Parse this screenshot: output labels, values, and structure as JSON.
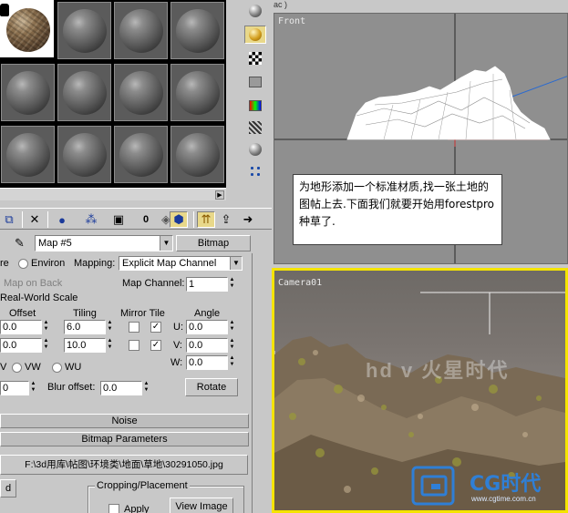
{
  "material_editor": {
    "slots": {
      "rows": 3,
      "cols": 4,
      "active_index": 0,
      "active_type": "rock-texture"
    },
    "side_tools": [
      "sample-type-icon",
      "backlight-icon",
      "background-checker-icon",
      "sample-uv-tiling-icon",
      "video-color-check-icon",
      "make-preview-icon",
      "options-icon",
      "select-by-material-icon"
    ],
    "toolbar": [
      "get-material-icon",
      "put-to-scene-icon",
      "assign-to-selection-icon",
      "reset-map-icon",
      "make-copy-icon",
      "make-unique-icon",
      "put-to-library-icon",
      "material-id-channel-icon",
      "show-map-in-viewport-icon",
      "show-end-result-icon",
      "go-to-parent-icon",
      "go-forward-to-sibling-icon"
    ],
    "map_name": "Map #5",
    "map_type_button": "Bitmap",
    "coordinates": {
      "texture_label": "re",
      "environ_label": "Environ",
      "mapping_label": "Mapping:",
      "mapping_value": "Explicit Map Channel",
      "map_on_back_label": "Map on Back",
      "map_channel_label": "Map Channel:",
      "map_channel_value": "1",
      "real_world_label": "Real-World Scale",
      "offset_label": "Offset",
      "tiling_label": "Tiling",
      "mirror_tile_label": "Mirror Tile",
      "angle_label": "Angle",
      "u_offset": "0.0",
      "v_offset": "0.0",
      "u_tiling": "6.0",
      "v_tiling": "10.0",
      "u_angle_label": "U:",
      "v_angle_label": "V:",
      "w_angle_label": "W:",
      "u_angle": "0.0",
      "v_angle": "0.0",
      "w_angle": "0.0",
      "uv_label": "V",
      "vw_label": "VW",
      "wu_label": "WU",
      "blur_value": "0",
      "blur_offset_label": "Blur offset:",
      "blur_offset_value": "0.0",
      "rotate_button": "Rotate"
    },
    "noise_rollout": "Noise",
    "bitmap_params_rollout": "Bitmap Parameters",
    "bitmap_path": "F:\\3d用库\\帖图\\环境类\\地面\\草地\\30291050.jpg",
    "reload_button": "d",
    "cropping_label": "Cropping/Placement",
    "apply_label": "Apply",
    "view_image_button": "View Image"
  },
  "viewports": {
    "top_strip_label": "ac )",
    "front_label": "Front",
    "note_text": "为地形添加一个标准材质,找一张土地的图帖上去.下面我们就要开始用forestpro种草了.",
    "camera_label": "Camera01",
    "watermark_text": "hd ᴠ 火星时代",
    "logo_text": "CG时代",
    "logo_url": "www.cgtime.com.cn"
  }
}
